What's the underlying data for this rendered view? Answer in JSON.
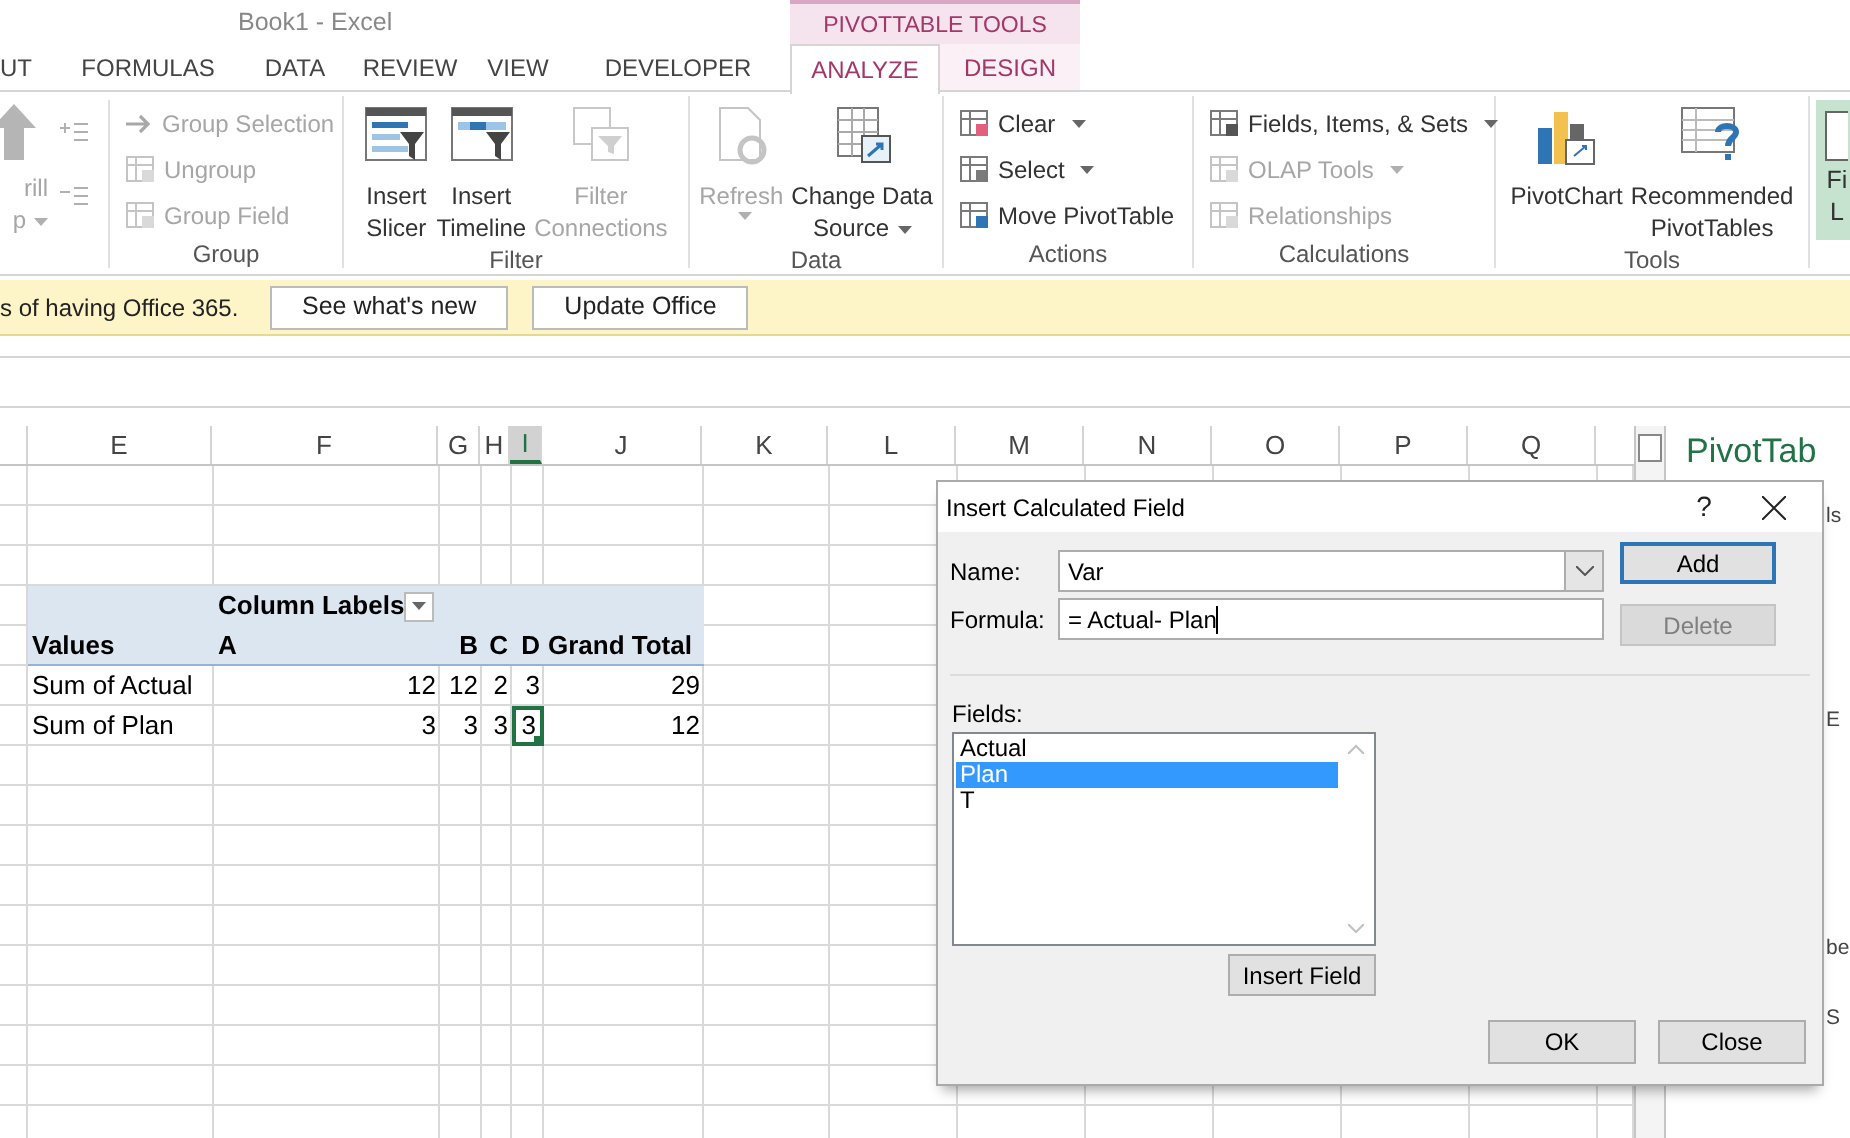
{
  "window": {
    "title": "Book1 - Excel",
    "context_group": "PIVOTTABLE TOOLS"
  },
  "tabs": [
    {
      "label": "UT",
      "selected": false,
      "contextual": false
    },
    {
      "label": "FORMULAS",
      "selected": false,
      "contextual": false
    },
    {
      "label": "DATA",
      "selected": false,
      "contextual": false
    },
    {
      "label": "REVIEW",
      "selected": false,
      "contextual": false
    },
    {
      "label": "VIEW",
      "selected": false,
      "contextual": false
    },
    {
      "label": "DEVELOPER",
      "selected": false,
      "contextual": false
    },
    {
      "label": "ANALYZE",
      "selected": true,
      "contextual": true
    },
    {
      "label": "DESIGN",
      "selected": false,
      "contextual": true
    }
  ],
  "ribbon": {
    "drill": {
      "label": "rill\np",
      "disabled": true,
      "has_menu": true
    },
    "groups": [
      {
        "label": "Group",
        "items": [
          {
            "label": "Group Selection",
            "kind": "small",
            "disabled": true,
            "has_menu": false
          },
          {
            "label": "Ungroup",
            "kind": "small",
            "disabled": true,
            "has_menu": false
          },
          {
            "label": "Group Field",
            "kind": "small",
            "disabled": true,
            "has_menu": false
          }
        ]
      },
      {
        "label": "Filter",
        "items": [
          {
            "label": "Insert\nSlicer",
            "kind": "large",
            "disabled": false,
            "has_menu": false
          },
          {
            "label": "Insert\nTimeline",
            "kind": "large",
            "disabled": false,
            "has_menu": false
          },
          {
            "label": "Filter\nConnections",
            "kind": "large",
            "disabled": true,
            "has_menu": false
          }
        ]
      },
      {
        "label": "Data",
        "items": [
          {
            "label": "Refresh",
            "kind": "large",
            "disabled": true,
            "has_menu": true
          },
          {
            "label": "Change Data\nSource",
            "kind": "large",
            "disabled": false,
            "has_menu": true
          }
        ]
      },
      {
        "label": "Actions",
        "items": [
          {
            "label": "Clear",
            "kind": "small",
            "disabled": false,
            "has_menu": true
          },
          {
            "label": "Select",
            "kind": "small",
            "disabled": false,
            "has_menu": true
          },
          {
            "label": "Move PivotTable",
            "kind": "small",
            "disabled": false,
            "has_menu": false
          }
        ]
      },
      {
        "label": "Calculations",
        "items": [
          {
            "label": "Fields, Items, & Sets",
            "kind": "small",
            "disabled": false,
            "has_menu": true
          },
          {
            "label": "OLAP Tools",
            "kind": "small",
            "disabled": true,
            "has_menu": true
          },
          {
            "label": "Relationships",
            "kind": "small",
            "disabled": true,
            "has_menu": false
          }
        ]
      },
      {
        "label": "Tools",
        "items": [
          {
            "label": "PivotChart",
            "kind": "large",
            "disabled": false,
            "has_menu": false
          },
          {
            "label": "Recommended\nPivotTables",
            "kind": "large",
            "disabled": false,
            "has_menu": false
          }
        ]
      }
    ],
    "field_list": {
      "label": "Fi\nL",
      "on": true
    }
  },
  "message_bar": {
    "text": "s of having Office 365.",
    "buttons": [
      "See what's new",
      "Update Office"
    ]
  },
  "columns": [
    {
      "label": "E",
      "selected": false
    },
    {
      "label": "F",
      "selected": false
    },
    {
      "label": "G",
      "selected": false
    },
    {
      "label": "H",
      "selected": false
    },
    {
      "label": "I",
      "selected": true
    },
    {
      "label": "J",
      "selected": false
    },
    {
      "label": "K",
      "selected": false
    },
    {
      "label": "L",
      "selected": false
    },
    {
      "label": "M",
      "selected": false
    },
    {
      "label": "N",
      "selected": false
    },
    {
      "label": "O",
      "selected": false
    },
    {
      "label": "P",
      "selected": false
    },
    {
      "label": "Q",
      "selected": false
    }
  ],
  "pivot": {
    "column_labels": "Column Labels",
    "headers": [
      "Values",
      "A",
      "B",
      "C",
      "D",
      "Grand Total"
    ],
    "rows": [
      {
        "label": "Sum of Actual",
        "values": [
          {
            "text": "12",
            "selected": false
          },
          {
            "text": "12",
            "selected": false
          },
          {
            "text": "2",
            "selected": false
          },
          {
            "text": "3",
            "selected": false
          },
          {
            "text": "29",
            "selected": false
          }
        ]
      },
      {
        "label": "Sum of Plan",
        "values": [
          {
            "text": "3",
            "selected": false
          },
          {
            "text": "3",
            "selected": false
          },
          {
            "text": "3",
            "selected": false
          },
          {
            "text": "3",
            "selected": true
          },
          {
            "text": "12",
            "selected": false
          }
        ]
      }
    ]
  },
  "side_pane": {
    "title": "PivotTab",
    "fragments": [
      "ls",
      "E",
      "be",
      "S"
    ]
  },
  "dialog": {
    "title": "Insert Calculated Field",
    "help": "?",
    "name_label": "Name:",
    "name_value": "Var",
    "formula_label": "Formula:",
    "formula_value": "= Actual- Plan",
    "fields_label": "Fields:",
    "fields": [
      {
        "label": "Actual",
        "selected": false
      },
      {
        "label": "Plan",
        "selected": true
      },
      {
        "label": "T",
        "selected": false
      }
    ],
    "add_button": {
      "label": "Add",
      "disabled": false,
      "default": true
    },
    "delete_button": {
      "label": "Delete",
      "disabled": true
    },
    "insert_field_button": "Insert Field",
    "ok_button": "OK",
    "close_button": "Close"
  }
}
